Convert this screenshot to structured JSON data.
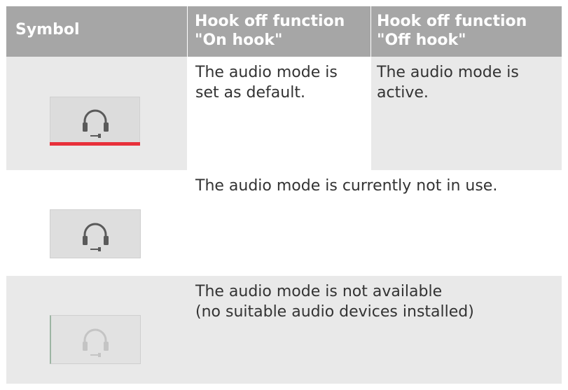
{
  "header": {
    "symbol": "Symbol",
    "on_hook_line1": "Hook off function",
    "on_hook_line2": "\"On hook\"",
    "off_hook_line1": "Hook off function",
    "off_hook_line2": "\"Off hook\""
  },
  "rows": [
    {
      "icon": "headset-icon",
      "state": "active",
      "on_hook_lines": [
        "The audio mode is",
        "set as default."
      ],
      "off_hook_lines": [
        "The audio mode is",
        "active."
      ]
    },
    {
      "icon": "headset-icon",
      "state": "inactive",
      "text_lines": [
        "The audio mode is currently not in use."
      ]
    },
    {
      "icon": "headset-icon",
      "state": "disabled",
      "text_lines": [
        "The audio mode is not available",
        "(no suitable audio devices installed)"
      ]
    }
  ],
  "colors": {
    "header_bg": "#a6a6a6",
    "row_grey": "#e9e9e9",
    "active_indicator": "#e8303a",
    "icon": "#5a5a5a",
    "icon_disabled": "#c4c4c4"
  }
}
